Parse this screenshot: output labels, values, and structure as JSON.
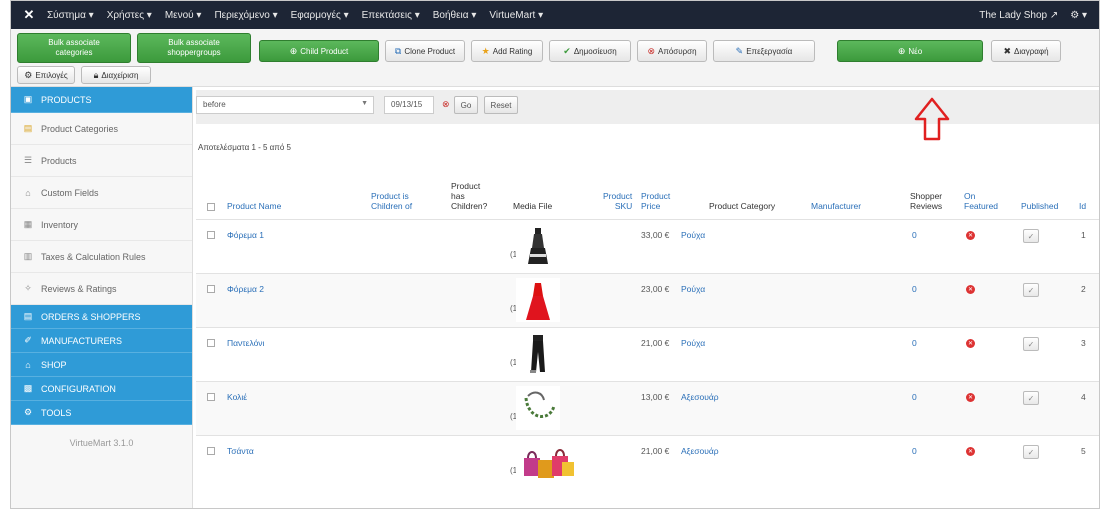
{
  "navbar": {
    "logo": "✕",
    "menus": [
      "Σύστημα ▾",
      "Χρήστες ▾",
      "Μενού ▾",
      "Περιεχόμενο ▾",
      "Εφαρμογές ▾",
      "Επεκτάσεις ▾",
      "Βοήθεια ▾",
      "VirtueMart ▾"
    ],
    "site_name": "The Lady Shop ↗",
    "settings": "⚙ ▾"
  },
  "toolbar": {
    "bulk_categories": [
      "Bulk associate",
      "categories"
    ],
    "bulk_shoppergroups": [
      "Bulk associate",
      "shoppergroups"
    ],
    "child_product": "Child Product",
    "clone_product": "Clone Product",
    "add_rating": "Add Rating",
    "publish": "Δημοσίευση",
    "unpublish": "Απόσυρση",
    "edit": "Επεξεργασία",
    "new": "Νέο",
    "delete": "Διαγραφή",
    "options": "Επιλογές",
    "help": "Διαχείριση"
  },
  "sidebar": {
    "items": [
      {
        "label": "PRODUCTS",
        "active": true,
        "icon": "box-icon"
      },
      {
        "label": "Product Categories",
        "active": false,
        "icon": "folder-icon"
      },
      {
        "label": "Products",
        "active": false,
        "icon": "list-icon"
      },
      {
        "label": "Custom Fields",
        "active": false,
        "icon": "tag-icon"
      },
      {
        "label": "Inventory",
        "active": false,
        "icon": "inventory-icon"
      },
      {
        "label": "Taxes & Calculation Rules",
        "active": false,
        "icon": "calculator-icon"
      },
      {
        "label": "Reviews & Ratings",
        "active": false,
        "icon": "star-icon"
      },
      {
        "label": "ORDERS & SHOPPERS",
        "active": true,
        "icon": "cart-icon"
      },
      {
        "label": "MANUFACTURERS",
        "active": true,
        "icon": "wrench-icon"
      },
      {
        "label": "SHOP",
        "active": true,
        "icon": "shop-icon"
      },
      {
        "label": "CONFIGURATION",
        "active": true,
        "icon": "config-icon"
      },
      {
        "label": "TOOLS",
        "active": true,
        "icon": "tools-icon"
      }
    ],
    "version": "VirtueMart 3.1.0"
  },
  "filters": {
    "select_value": "before",
    "date_value": "09/13/15",
    "go_label": "Go",
    "reset_label": "Reset",
    "pagination": "Αποτελέσματα 1 - 5 από 5"
  },
  "table": {
    "headers": {
      "name": "Product Name",
      "children_of": [
        "Product is",
        "Children of"
      ],
      "has_children": [
        "Product",
        "has",
        "Children?"
      ],
      "media": "Media File",
      "sku": [
        "Product",
        "SKU"
      ],
      "price": [
        "Product",
        "Price"
      ],
      "category": "Product Category",
      "manufacturer": "Manufacturer",
      "reviews": [
        "Shopper",
        "Reviews"
      ],
      "featured": [
        "On",
        "Featured"
      ],
      "published": "Published",
      "id": "Id"
    },
    "rows": [
      {
        "name": "Φόρεμα 1",
        "media_count": "(1)",
        "price": "33,00 €",
        "category": "Ρούχα",
        "reviews": "0",
        "id": "1",
        "thumb": "dress-black"
      },
      {
        "name": "Φόρεμα 2",
        "media_count": "(1)",
        "price": "23,00 €",
        "category": "Ρούχα",
        "reviews": "0",
        "id": "2",
        "thumb": "dress-red"
      },
      {
        "name": "Παντελόνι",
        "media_count": "(1)",
        "price": "21,00 €",
        "category": "Ρούχα",
        "reviews": "0",
        "id": "3",
        "thumb": "pants"
      },
      {
        "name": "Κολιέ",
        "media_count": "(1)",
        "price": "13,00 €",
        "category": "Αξεσουάρ",
        "reviews": "0",
        "id": "4",
        "thumb": "necklace"
      },
      {
        "name": "Τσάντα",
        "media_count": "(1)",
        "price": "21,00 €",
        "category": "Αξεσουάρ",
        "reviews": "0",
        "id": "5",
        "thumb": "bags"
      }
    ]
  },
  "colors": {
    "navbar": "#1d2535",
    "sidebar_active": "#2f9bd7",
    "green_button": "#4cae4c",
    "link": "#2a6fb8",
    "annotation_arrow": "#e02020"
  }
}
